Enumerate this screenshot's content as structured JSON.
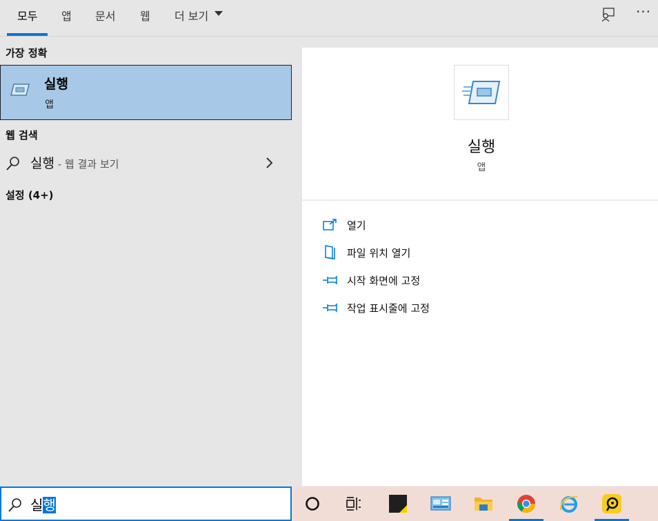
{
  "tabs": [
    {
      "label": "모두",
      "active": true
    },
    {
      "label": "앱"
    },
    {
      "label": "문서"
    },
    {
      "label": "웹"
    },
    {
      "label": "더 보기"
    }
  ],
  "toolbar": {
    "feedback_icon": "feedback-icon",
    "more_icon": "more-options-icon",
    "more_glyph": "···"
  },
  "left": {
    "best_match_heading": "가장 정확",
    "best_match": {
      "title": "실행",
      "type": "앱",
      "icon": "run-app-icon"
    },
    "web_heading": "웹 검색",
    "web_result": {
      "query": "실행",
      "hint": " - 웹 결과 보기"
    },
    "settings_heading": "설정 (4+)"
  },
  "detail": {
    "title": "실행",
    "type": "앱",
    "actions": [
      {
        "label": "열기",
        "icon": "open-icon"
      },
      {
        "label": "파일 위치 열기",
        "icon": "file-location-icon"
      },
      {
        "label": "시작 화면에 고정",
        "icon": "pin-icon"
      },
      {
        "label": "작업 표시줄에 고정",
        "icon": "pin-icon"
      }
    ]
  },
  "search": {
    "typed_prefix": "실",
    "typed_selected": "행"
  },
  "taskbar": [
    "cortana-icon",
    "task-view-icon",
    "sticky-notes-icon",
    "control-panel-icon",
    "file-explorer-icon",
    "chrome-icon",
    "internet-explorer-icon",
    "remote-support-icon"
  ],
  "colors": {
    "accent": "#0078d7",
    "selection": "#a7c8e6",
    "taskbar": "#f2ddd6"
  }
}
